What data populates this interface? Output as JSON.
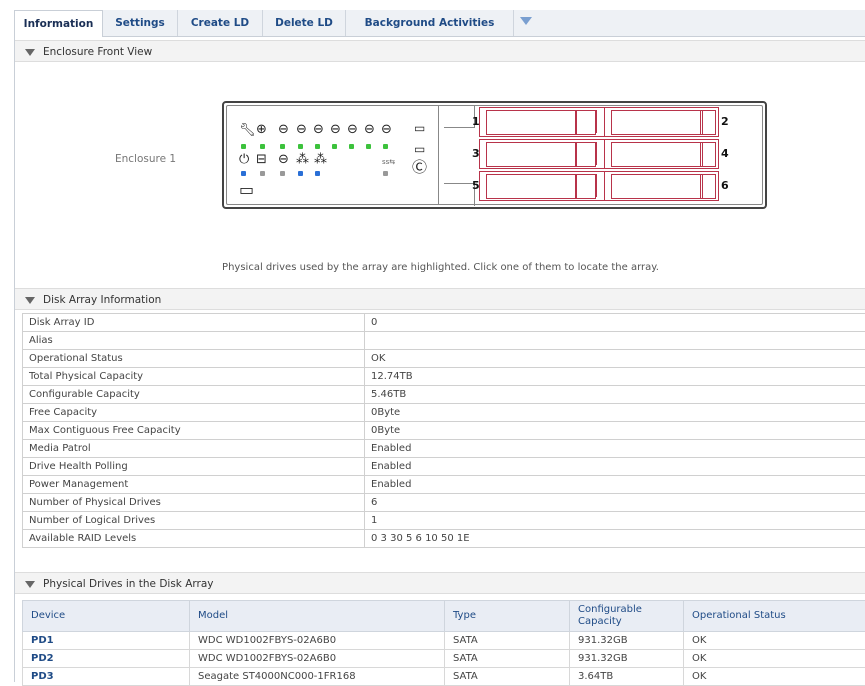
{
  "tabs": [
    "Information",
    "Settings",
    "Create LD",
    "Delete LD",
    "Background Activities"
  ],
  "sections": {
    "enclosure_title": "Enclosure Front View",
    "array_title": "Disk Array Information",
    "drives_title": "Physical Drives in the Disk Array"
  },
  "enclosure": {
    "label": "Enclosure 1",
    "bays": [
      "1",
      "2",
      "3",
      "4",
      "5",
      "6"
    ],
    "note": "Physical drives used by the array are highlighted. Click one of them to locate the array.",
    "highlight_color": "#b8334a",
    "led_green": "#3cc23c",
    "led_blue": "#2a6fd6"
  },
  "array_info": [
    {
      "key": "Disk Array ID",
      "value": "0"
    },
    {
      "key": "Alias",
      "value": ""
    },
    {
      "key": "Operational Status",
      "value": "OK"
    },
    {
      "key": "Total Physical Capacity",
      "value": "12.74TB"
    },
    {
      "key": "Configurable Capacity",
      "value": "5.46TB"
    },
    {
      "key": "Free Capacity",
      "value": "0Byte"
    },
    {
      "key": "Max Contiguous Free Capacity",
      "value": "0Byte"
    },
    {
      "key": "Media Patrol",
      "value": "Enabled"
    },
    {
      "key": "Drive Health Polling",
      "value": "Enabled"
    },
    {
      "key": "Power Management",
      "value": "Enabled"
    },
    {
      "key": "Number of Physical Drives",
      "value": "6"
    },
    {
      "key": "Number of Logical Drives",
      "value": "1"
    },
    {
      "key": "Available RAID Levels",
      "value": "0 3 30 5 6 10 50 1E"
    }
  ],
  "drives": {
    "headers": [
      "Device",
      "Model",
      "Type",
      "Configurable Capacity",
      "Operational Status"
    ],
    "rows": [
      {
        "device": "PD1",
        "model": "WDC WD1002FBYS-02A6B0",
        "type": "SATA",
        "capacity": "931.32GB",
        "status": "OK"
      },
      {
        "device": "PD2",
        "model": "WDC WD1002FBYS-02A6B0",
        "type": "SATA",
        "capacity": "931.32GB",
        "status": "OK"
      },
      {
        "device": "PD3",
        "model": "Seagate ST4000NC000-1FR168",
        "type": "SATA",
        "capacity": "3.64TB",
        "status": "OK"
      }
    ]
  }
}
